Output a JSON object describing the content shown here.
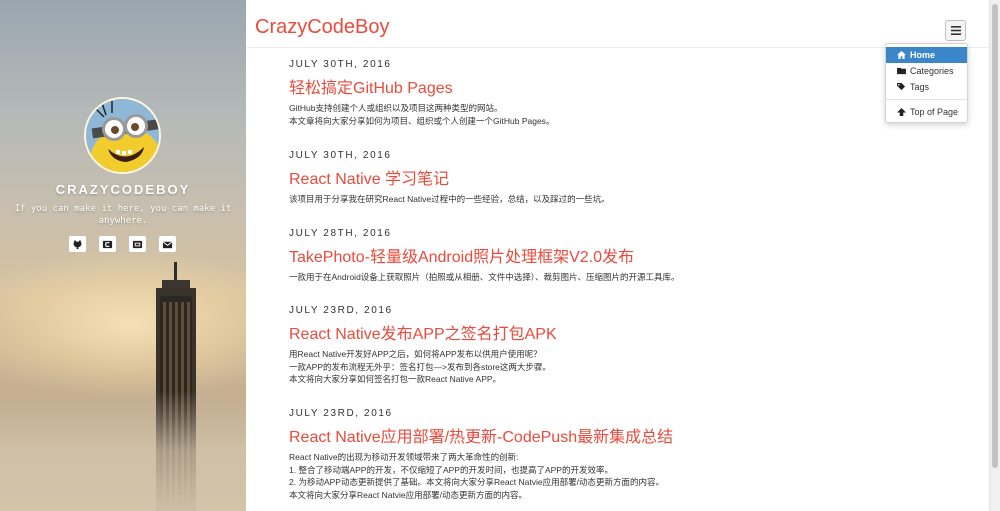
{
  "sidebar": {
    "site_name": "CRAZYCODEBOY",
    "tagline": "If you can make it here, you can make it anywhere.",
    "social_icons": [
      "github-icon",
      "csdn-icon",
      "weibo-icon",
      "email-icon"
    ]
  },
  "header": {
    "brand": "CrazyCodeBoy",
    "menu_icon": "hamburger-icon"
  },
  "dropdown": {
    "items": [
      {
        "label": "Home",
        "icon": "home-icon",
        "active": true
      },
      {
        "label": "Categories",
        "icon": "folder-icon",
        "active": false
      },
      {
        "label": "Tags",
        "icon": "tags-icon",
        "active": false
      },
      {
        "label": "Top of Page",
        "icon": "arrow-up-icon",
        "active": false
      }
    ]
  },
  "posts": [
    {
      "date": "JULY 30TH, 2016",
      "title": "轻松搞定GitHub Pages",
      "excerpt": [
        "GitHub支持创建个人或组织以及项目这两种类型的网站。",
        "本文章将向大家分享如何为项目、组织或个人创建一个GitHub Pages。"
      ]
    },
    {
      "date": "JULY 30TH, 2016",
      "title": "React Native 学习笔记",
      "excerpt": [
        "该项目用于分享我在研究React Native过程中的一些经验，总结，以及踩过的一些坑。"
      ]
    },
    {
      "date": "JULY 28TH, 2016",
      "title": "TakePhoto-轻量级Android照片处理框架V2.0发布",
      "excerpt": [
        "一款用于在Android设备上获取照片（拍照或从相册、文件中选择）、裁剪图片、压缩图片的开源工具库。"
      ]
    },
    {
      "date": "JULY 23RD, 2016",
      "title": "React Native发布APP之签名打包APK",
      "excerpt": [
        "用React Native开发好APP之后，如何将APP发布以供用户使用呢？",
        "一款APP的发布流程无外乎：签名打包—>发布到各store这两大步骤。",
        "本文将向大家分享如何签名打包一款React Native APP。"
      ]
    },
    {
      "date": "JULY 23RD, 2016",
      "title": "React Native应用部署/热更新-CodePush最新集成总结",
      "excerpt": [
        "React Native的出现为移动开发领域带来了两大革命性的创新:",
        "1. 整合了移动端APP的开发，不仅缩短了APP的开发时间，也提高了APP的开发效率。",
        "2. 为移动APP动态更新提供了基础。本文将向大家分享React Natvie应用部署/动态更新方面的内容。",
        "本文将向大家分享React Natvie应用部署/动态更新方面的内容。"
      ]
    }
  ],
  "colors": {
    "accent": "#e94b3c",
    "menu_active": "#3b85c9"
  }
}
